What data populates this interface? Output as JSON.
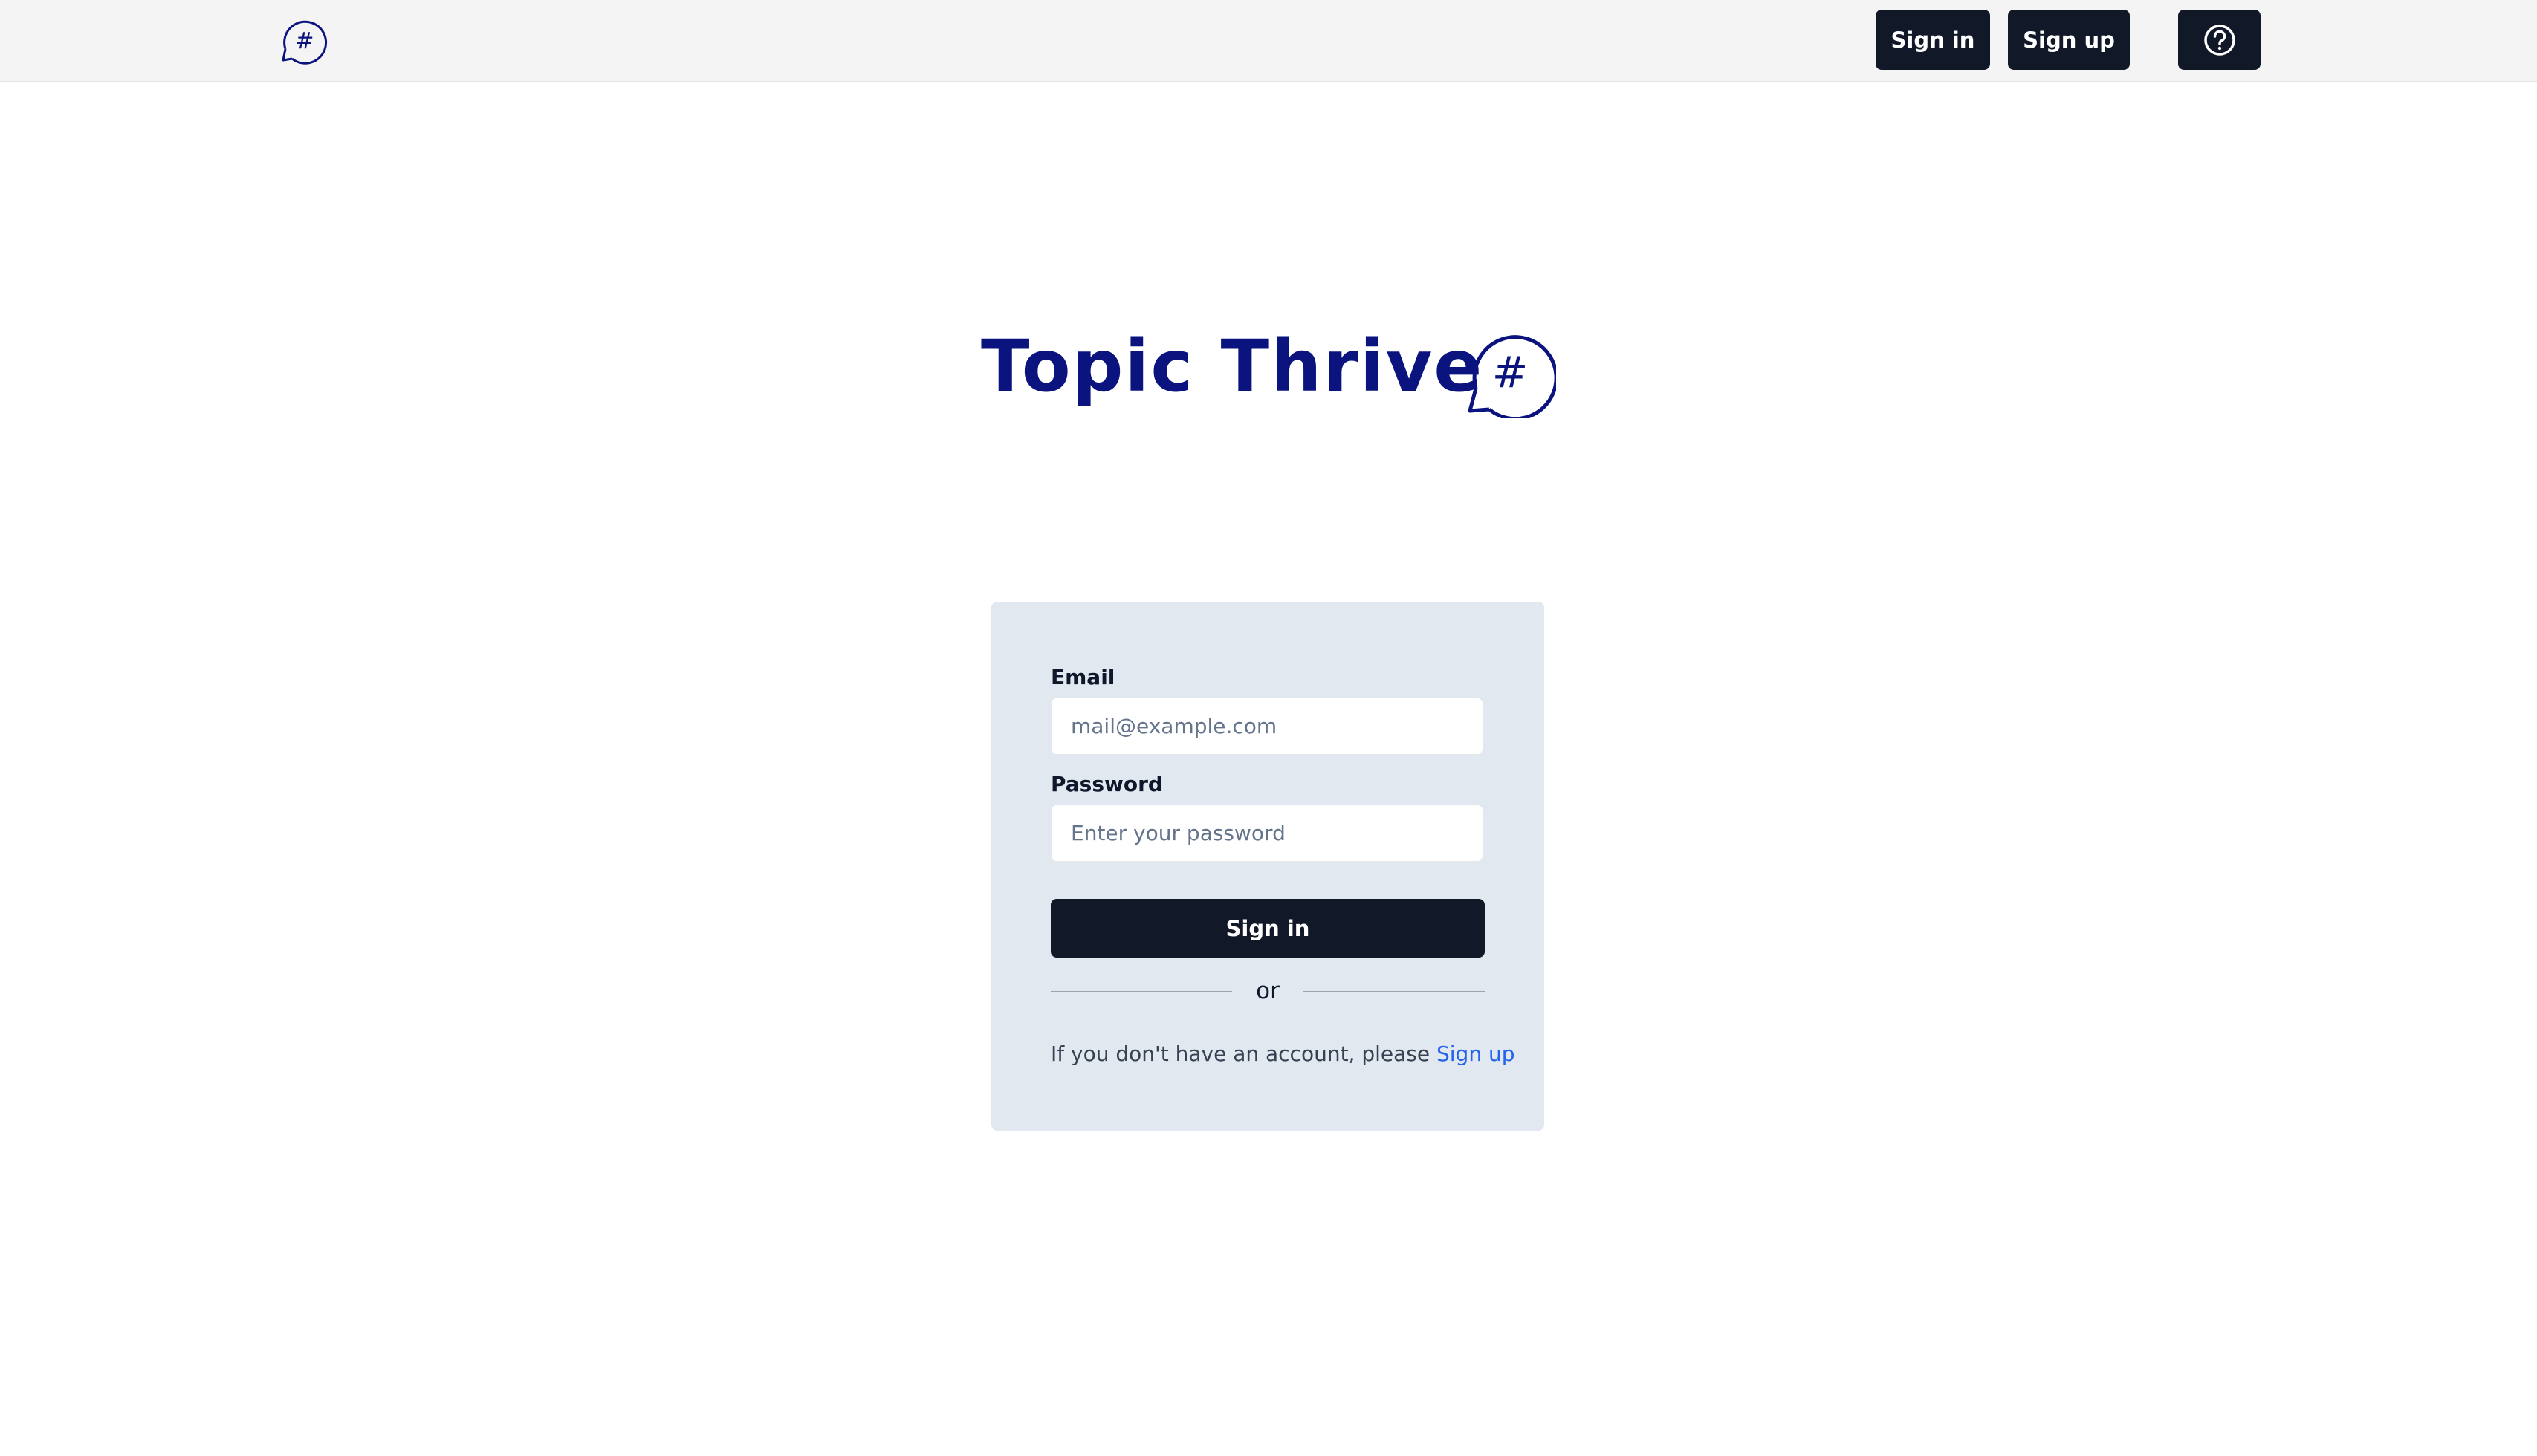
{
  "app": {
    "name": "Topic Thrive",
    "brand_color": "#0a137e",
    "logo_icon": "hashtag-chat-bubble-icon"
  },
  "header": {
    "signin_label": "Sign in",
    "signup_label": "Sign up",
    "help_icon": "question-circle-icon"
  },
  "form": {
    "email_label": "Email",
    "email_placeholder": "mail@example.com",
    "email_value": "",
    "password_label": "Password",
    "password_placeholder": "Enter your password",
    "password_value": "",
    "submit_label": "Sign in",
    "divider_text": "or",
    "signup_prompt": "If you don't have an account, please ",
    "signup_link": "Sign up"
  },
  "colors": {
    "button_bg": "#111827",
    "card_bg": "#e2e8f0",
    "link": "#2563eb",
    "header_bg": "#f4f4f5"
  }
}
